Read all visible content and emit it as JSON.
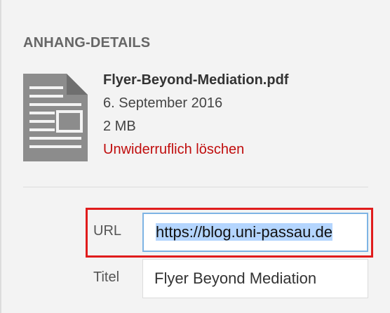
{
  "section": {
    "title": "ANHANG-DETAILS"
  },
  "file": {
    "icon": "document-icon",
    "name": "Flyer-Beyond-Mediation.pdf",
    "date": "6. September 2016",
    "size": "2 MB",
    "delete_label": "Unwiderruflich löschen"
  },
  "fields": {
    "url": {
      "label": "URL",
      "value": "https://blog.uni-passau.de"
    },
    "title": {
      "label": "Titel",
      "value": "Flyer Beyond Mediation"
    }
  },
  "colors": {
    "delete_link": "#c00d0d",
    "highlight_box": "#e01c1c",
    "selection": "#b4d5fe",
    "focus_border": "#7eb4e4"
  }
}
